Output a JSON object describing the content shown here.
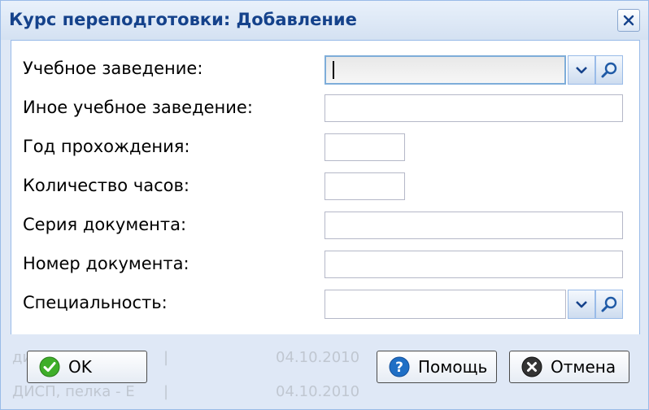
{
  "window": {
    "title": "Курс переподготовки: Добавление",
    "close_icon": "close-icon"
  },
  "form": {
    "fields": [
      {
        "label": "Учебное заведение:",
        "type": "combo-search",
        "value": "",
        "focused": true
      },
      {
        "label": "Иное учебное заведение:",
        "type": "text",
        "value": ""
      },
      {
        "label": "Год прохождения:",
        "type": "text-short",
        "value": ""
      },
      {
        "label": "Количество часов:",
        "type": "text-short",
        "value": ""
      },
      {
        "label": "Серия документа:",
        "type": "text",
        "value": ""
      },
      {
        "label": "Номер документа:",
        "type": "text",
        "value": ""
      },
      {
        "label": "Специальность:",
        "type": "combo-search",
        "value": ""
      }
    ]
  },
  "background_rows": [
    {
      "left": "ди",
      "mid": "|",
      "date": "04.10.2010"
    },
    {
      "left": "ДИСП, пелка - Е",
      "mid": "|",
      "date": "04.10.2010"
    }
  ],
  "buttons": {
    "ok": {
      "label": "OK",
      "icon": "checkmark-icon"
    },
    "help": {
      "label": "Помощь",
      "icon": "help-icon"
    },
    "cancel": {
      "label": "Отмена",
      "icon": "cancel-icon"
    }
  },
  "colors": {
    "title": "#15428b",
    "window_bg": "#dfe8f6",
    "border": "#99bbe8",
    "ok_green": "#3fae2a",
    "help_blue": "#1f6fc5",
    "cancel_dark": "#333333"
  }
}
